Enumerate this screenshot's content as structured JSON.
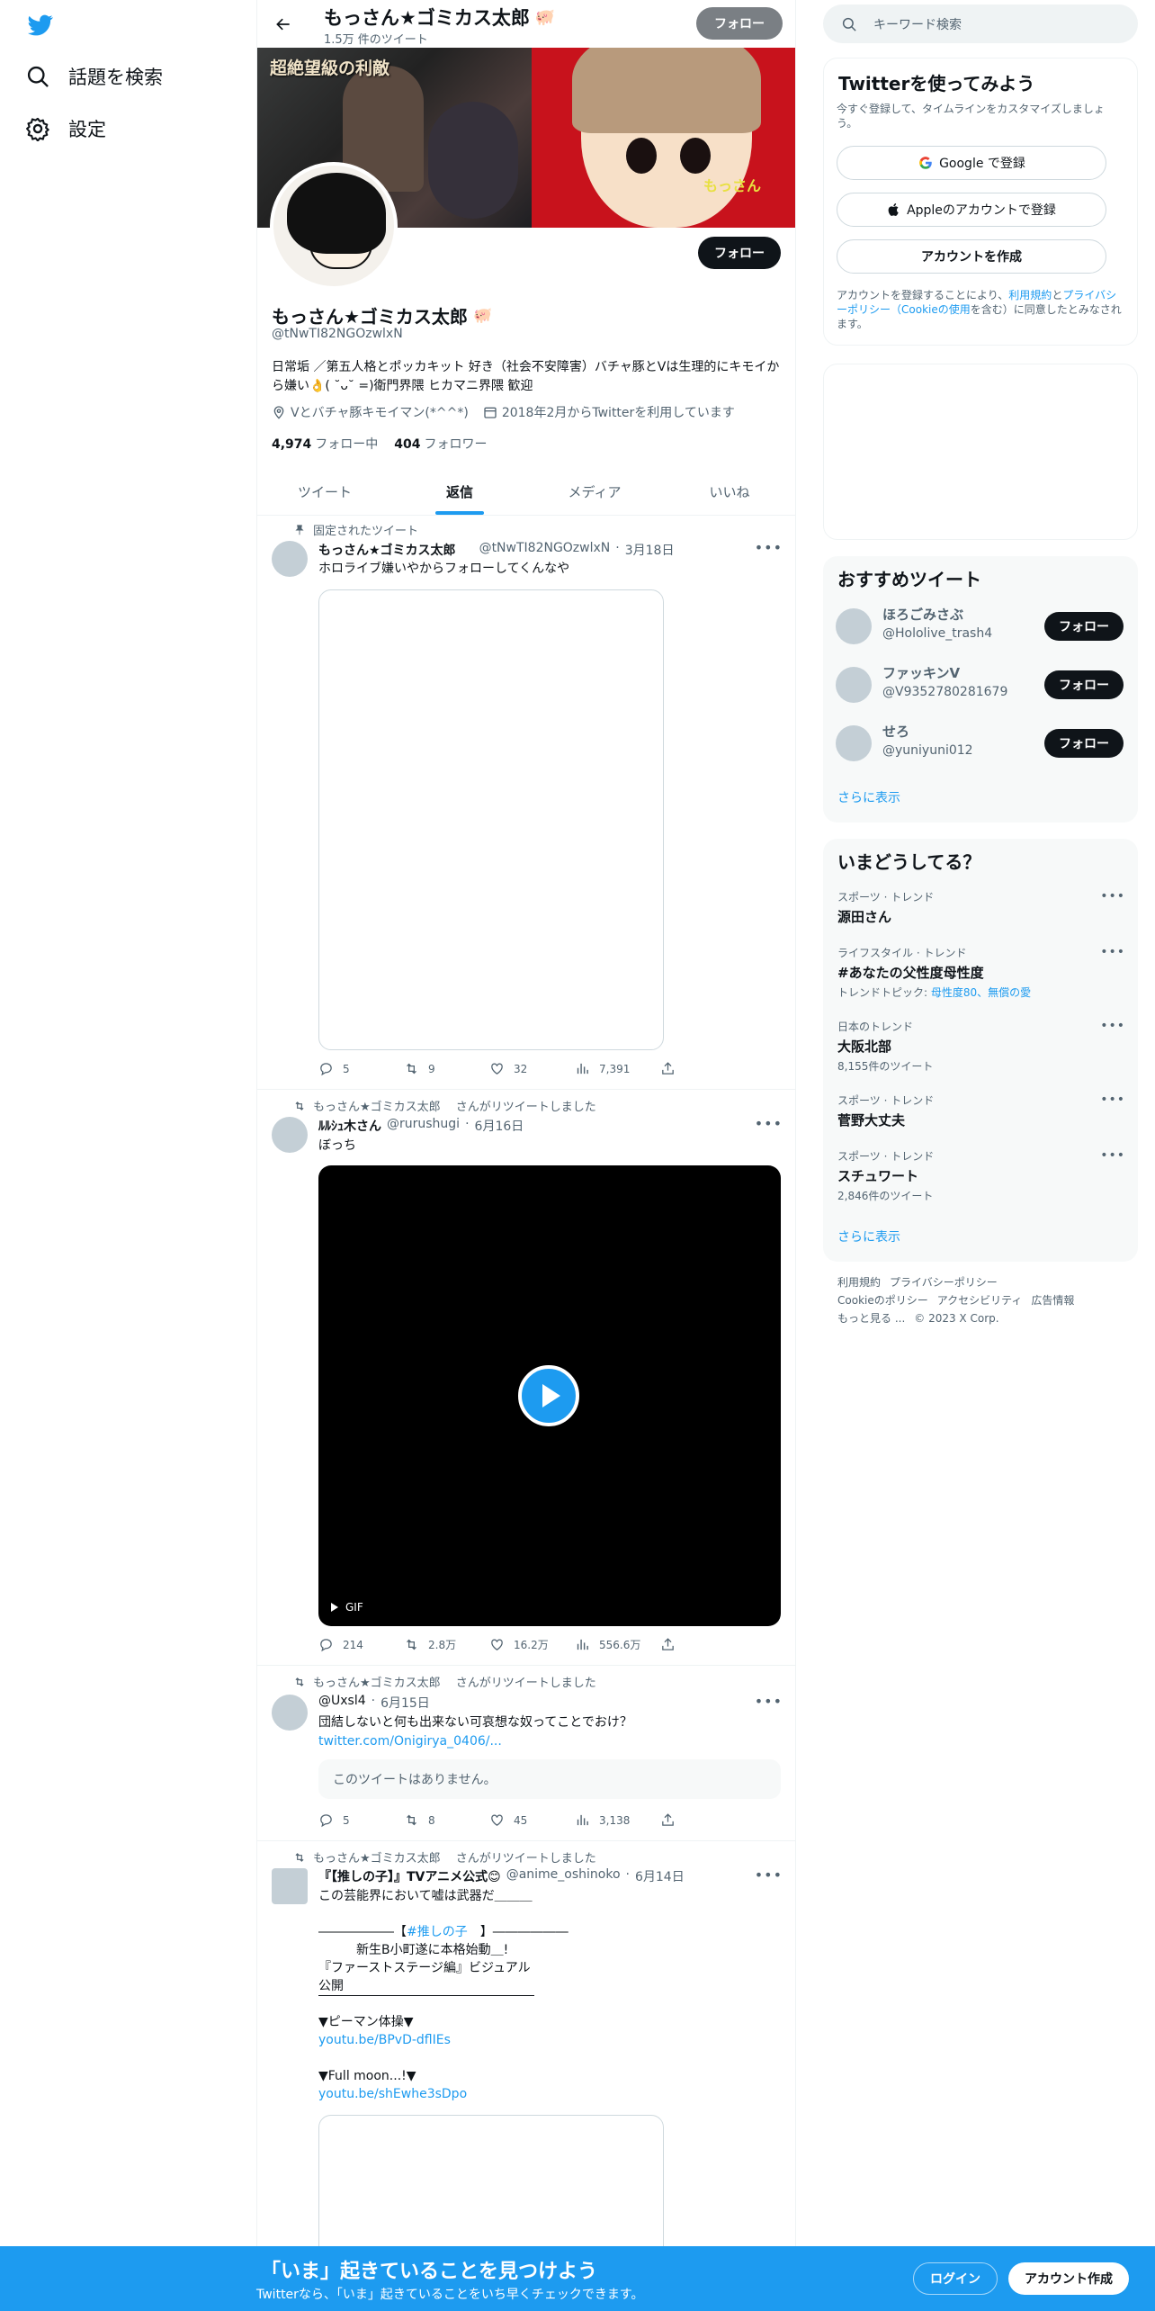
{
  "nav": {
    "explore": "話題を検索",
    "settings": "設定"
  },
  "profile_header": {
    "name": "もっさん★ゴミカス太郎",
    "tweet_count": "1.5万 件のツイート",
    "follow": "フォロー"
  },
  "banner": {
    "left_text": "超絶望級の利敵",
    "right_text": "もっさん"
  },
  "profile": {
    "name": "もっさん★ゴミカス太郎",
    "handle": "@tNwTI82NGOzwlxN",
    "bio": "日常垢 ／第五人格とポッカキット 好き（社会不安障害）バチャ豚とVは生理的にキモイから嫌い👌( ˘ᴗ˘ =)衛門界隈 ヒカマニ界隈 歓迎",
    "location": "Vとバチャ豚キモイマン(*^^*)",
    "joined": "2018年2月からTwitterを利用しています",
    "following_count": "4,974",
    "following_label": "フォロー中",
    "followers_count": "404",
    "followers_label": "フォロワー",
    "follow_button": "フォロー"
  },
  "tabs": [
    "ツイート",
    "返信",
    "メディア",
    "いいね"
  ],
  "active_tab": "返信",
  "tweets": [
    {
      "context": "固定されたツイート",
      "name": "もっさん★ゴミカス太郎",
      "handle": "@tNwTI82NGOzwlxN",
      "date": "3月18日",
      "text": "ホロライブ嫌いやからフォローしてくんなや",
      "replies": "5",
      "retweets": "9",
      "likes": "32",
      "views": "7,391"
    },
    {
      "context": "もっさん★ゴミカス太郎　 さんがリツイートしました",
      "name": "ﾙﾙｼｭ木さん",
      "handle": "@rurushugi",
      "date": "6月16日",
      "text": "ぼっち",
      "media_label": "GIF",
      "replies": "214",
      "retweets": "2.8万",
      "likes": "16.2万",
      "views": "556.6万"
    },
    {
      "context": "もっさん★ゴミカス太郎　 さんがリツイートしました",
      "name": "",
      "handle": "@Uxsl4",
      "date": "6月15日",
      "text": "団結しないと何も出来ない可哀想な奴ってことでおけ？",
      "link": "twitter.com/Onigirya_0406/...",
      "quote": "このツイートはありません。",
      "replies": "5",
      "retweets": "8",
      "likes": "45",
      "views": "3,138"
    },
    {
      "context": "もっさん★ゴミカス太郎　 さんがリツイートしました",
      "name": "『【推しの子】』TVアニメ公式😊",
      "handle": "@anime_oshinoko",
      "date": "6月14日",
      "line1": "この芸能界において嘘は武器だ＿＿＿",
      "line2a": "――――――【",
      "hashtag": "#推しの子",
      "line2b": "　】――――――",
      "line3": "　　　新生B小町遂に本格始動＿!",
      "line4": "『ファーストステージ編』ビジュアル公開",
      "line5": "▼ピーマン体操▼",
      "link1": "youtu.be/BPvD-dflIEs",
      "line6": "▼Full moon...!▼",
      "link2": "youtu.be/shEwhe3sDpo"
    }
  ],
  "search": {
    "placeholder": "キーワード検索"
  },
  "signup_card": {
    "title": "Twitterを使ってみよう",
    "subtitle": "今すぐ登録して、タイムラインをカスタマイズしましょう。",
    "google": "Google で登録",
    "apple": "Appleのアカウントで登録",
    "create": "アカウントを作成",
    "terms_pre": "アカウントを登録することにより、",
    "terms_link1": "利用規約",
    "terms_mid": "と",
    "terms_link2": "プライバシーポリシー（Cookieの使用",
    "terms_post": "を含む）に同意したとみなされます。"
  },
  "suggestions": {
    "title": "おすすめツイート",
    "users": [
      {
        "name": "ほろごみさぶ",
        "handle": "@Hololive_trash4",
        "button": "フォロー"
      },
      {
        "name": "ファッキンV",
        "handle": "@V9352780281679",
        "button": "フォロー"
      },
      {
        "name": "せろ",
        "handle": "@yuniyuni012",
        "button": "フォロー"
      }
    ],
    "more": "さらに表示"
  },
  "trends": {
    "title": "いまどうしてる？",
    "items": [
      {
        "category": "スポーツ · トレンド",
        "title": "源田さん",
        "sub": ""
      },
      {
        "category": "ライフスタイル · トレンド",
        "title": "#あなたの父性度母性度",
        "sub_pre": "トレンドトピック: ",
        "sub_link": "母性度80、無償の愛"
      },
      {
        "category": "日本のトレンド",
        "title": "大阪北部",
        "sub": "8,155件のツイート"
      },
      {
        "category": "スポーツ · トレンド",
        "title": "菅野大丈夫",
        "sub": ""
      },
      {
        "category": "スポーツ · トレンド",
        "title": "スチュワート",
        "sub": "2,846件のツイート"
      }
    ],
    "more": "さらに表示"
  },
  "footer": {
    "terms": "利用規約",
    "privacy": "プライバシーポリシー",
    "cookie": "Cookieのポリシー",
    "accessibility": "アクセシビリティ",
    "ads": "広告情報",
    "more": "もっと見る ...",
    "copyright": "© 2023 X Corp."
  },
  "bottom_bar": {
    "title": "「いま」起きていることを見つけよう",
    "subtitle": "Twitterなら、「いま」起きていることをいち早くチェックできます。",
    "login": "ログイン",
    "signup": "アカウント作成"
  },
  "colors": {
    "accent": "#1d9bf0",
    "text": "#0f1419",
    "muted": "#536471"
  }
}
